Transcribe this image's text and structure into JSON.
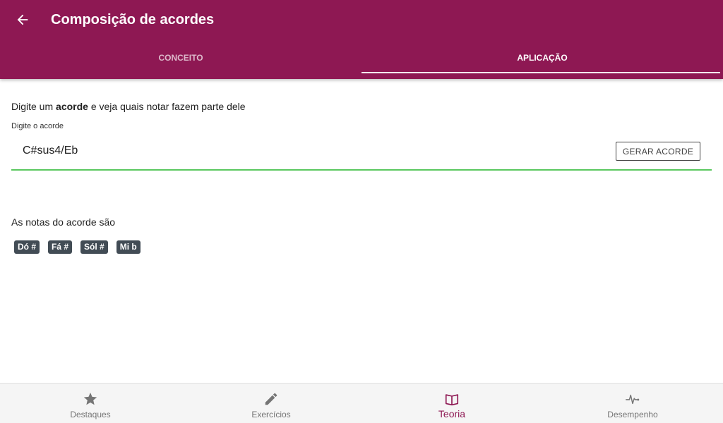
{
  "header": {
    "title": "Composição de acordes",
    "tabs": [
      {
        "label": "CONCEITO",
        "active": false
      },
      {
        "label": "APLICAÇÃO",
        "active": true
      }
    ]
  },
  "main": {
    "intro_before": "Digite um ",
    "intro_bold": "acorde",
    "intro_after": " e veja quais notar fazem parte dele",
    "field_label": "Digite o acorde",
    "chord_value": "C#sus4/Eb",
    "generate_button": "GERAR ACORDE",
    "result_label": "As notas do acorde são",
    "notes": [
      "Dó #",
      "Fá #",
      "Sól #",
      "Mi b"
    ]
  },
  "bottom_nav": {
    "items": [
      {
        "label": "Destaques",
        "icon": "star-icon",
        "active": false
      },
      {
        "label": "Exercícios",
        "icon": "pencil-icon",
        "active": false
      },
      {
        "label": "Teoria",
        "icon": "book-icon",
        "active": true
      },
      {
        "label": "Desempenho",
        "icon": "pulse-icon",
        "active": false
      }
    ]
  },
  "colors": {
    "primary": "#8e1853",
    "input_underline": "#5ac85f",
    "chip_bg": "#424c55"
  }
}
